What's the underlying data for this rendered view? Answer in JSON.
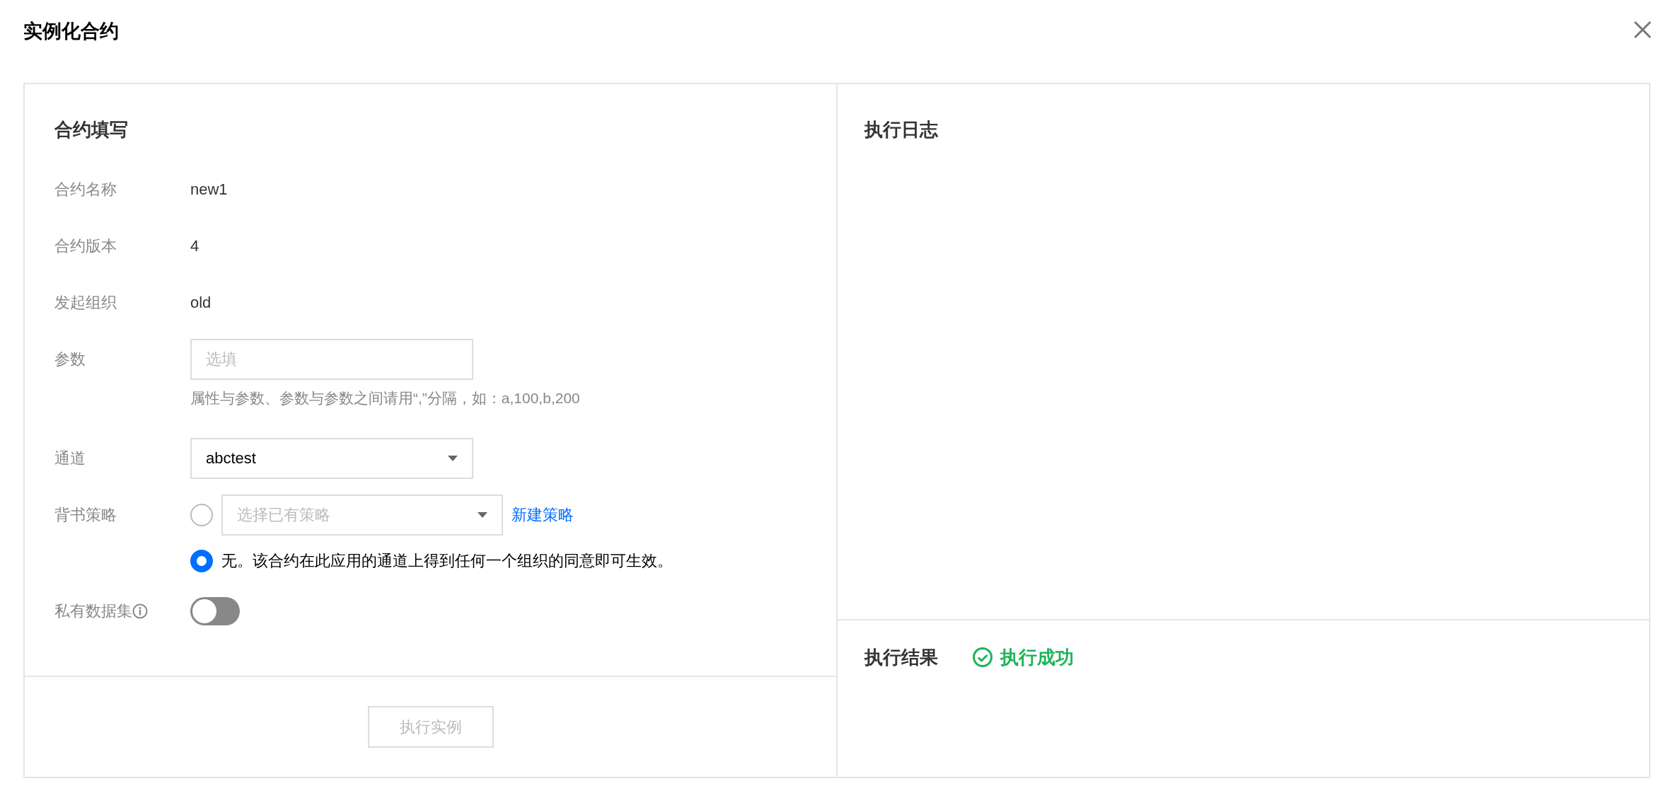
{
  "window": {
    "title": "实例化合约"
  },
  "form": {
    "heading": "合约填写",
    "fields": [
      {
        "kind": "text",
        "label": "合约名称",
        "value": "new1"
      },
      {
        "kind": "text",
        "label": "合约版本",
        "value": "4"
      },
      {
        "kind": "text",
        "label": "发起组织",
        "value": "old"
      },
      {
        "kind": "input",
        "label": "参数",
        "placeholder": "选填",
        "hint": "属性与参数、参数与参数之间请用“,”分隔，如：a,100,b,200"
      },
      {
        "kind": "select",
        "label": "通道",
        "value": "abctest"
      },
      {
        "kind": "choice",
        "label": "背书策略",
        "options": [
          {
            "kind": "select",
            "selected": false,
            "placeholder": "选择已有策略",
            "link": "新建策略"
          },
          {
            "kind": "text",
            "selected": true,
            "text": "无。该合约在此应用的通道上得到任何一个组织的同意即可生效。"
          }
        ]
      },
      {
        "kind": "toggle",
        "label": "私有数据集",
        "on": false
      }
    ],
    "submit_button": {
      "label": "执行实例",
      "disabled": true
    }
  },
  "log": {
    "heading": "执行日志"
  },
  "result": {
    "label": "执行结果",
    "status": "执行成功"
  }
}
